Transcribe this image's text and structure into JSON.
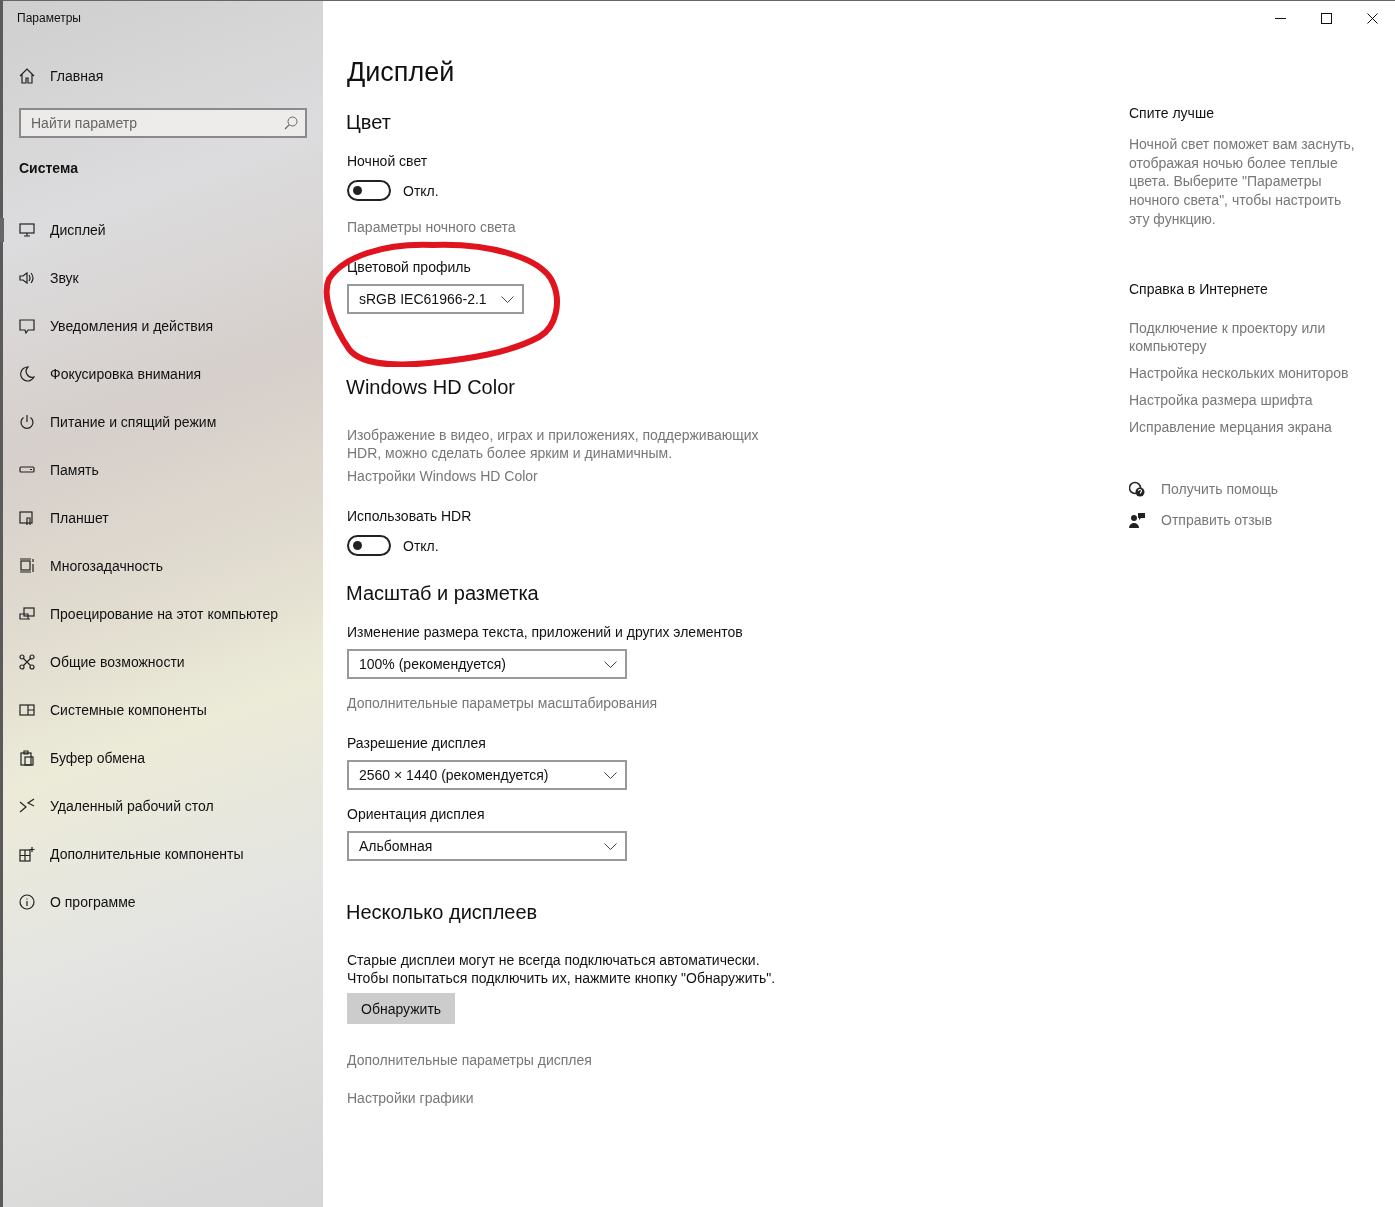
{
  "window": {
    "title": "Параметры",
    "controls": [
      {
        "kind": "minimize"
      },
      {
        "kind": "maximize"
      },
      {
        "kind": "close"
      }
    ]
  },
  "sidebar": {
    "home": {
      "label": "Главная"
    },
    "search": {
      "placeholder": "Найти параметр"
    },
    "section": "Система",
    "items": [
      {
        "label": "Дисплей",
        "selected": true
      },
      {
        "label": "Звук",
        "selected": false
      },
      {
        "label": "Уведомления и действия",
        "selected": false
      },
      {
        "label": "Фокусировка внимания",
        "selected": false
      },
      {
        "label": "Питание и спящий режим",
        "selected": false
      },
      {
        "label": "Память",
        "selected": false
      },
      {
        "label": "Планшет",
        "selected": false
      },
      {
        "label": "Многозадачность",
        "selected": false
      },
      {
        "label": "Проецирование на этот компьютер",
        "selected": false
      },
      {
        "label": "Общие возможности",
        "selected": false
      },
      {
        "label": "Системные компоненты",
        "selected": false
      },
      {
        "label": "Буфер обмена",
        "selected": false
      },
      {
        "label": "Удаленный рабочий стол",
        "selected": false
      },
      {
        "label": "Дополнительные компоненты",
        "selected": false
      },
      {
        "label": "О программе",
        "selected": false
      }
    ]
  },
  "page": {
    "title": "Дисплей",
    "sections": [
      {
        "heading": "Цвет",
        "items": [
          {
            "kind": "label",
            "text": "Ночной свет"
          },
          {
            "kind": "toggle",
            "on": false,
            "state": "Откл."
          },
          {
            "kind": "link",
            "text": "Параметры ночного света"
          },
          {
            "kind": "label",
            "text": "Цветовой профиль"
          },
          {
            "kind": "dropdown",
            "value": "sRGB IEC61966-2.1"
          }
        ]
      },
      {
        "heading": "Windows HD Color",
        "items": [
          {
            "kind": "note",
            "text": "Изображение в видео, играх и приложениях, поддерживающих HDR, можно сделать более ярким и динамичным."
          },
          {
            "kind": "link",
            "text": "Настройки Windows HD Color"
          },
          {
            "kind": "label",
            "text": "Использовать HDR"
          },
          {
            "kind": "toggle",
            "on": false,
            "state": "Откл."
          }
        ]
      },
      {
        "heading": "Масштаб и разметка",
        "items": [
          {
            "kind": "label",
            "text": "Изменение размера текста, приложений и других элементов"
          },
          {
            "kind": "dropdown",
            "value": "100% (рекомендуется)"
          },
          {
            "kind": "link",
            "text": "Дополнительные параметры масштабирования"
          },
          {
            "kind": "label",
            "text": "Разрешение дисплея"
          },
          {
            "kind": "dropdown",
            "value": "2560 × 1440 (рекомендуется)"
          },
          {
            "kind": "label",
            "text": "Ориентация дисплея"
          },
          {
            "kind": "dropdown",
            "value": "Альбомная"
          }
        ]
      },
      {
        "heading": "Несколько дисплеев",
        "items": [
          {
            "kind": "text",
            "text": "Старые дисплеи могут не всегда подключаться автоматически. Чтобы попытаться подключить их, нажмите кнопку \"Обнаружить\"."
          },
          {
            "kind": "button",
            "text": "Обнаружить"
          },
          {
            "kind": "link",
            "text": "Дополнительные параметры дисплея"
          },
          {
            "kind": "link",
            "text": "Настройки графики"
          }
        ]
      }
    ]
  },
  "annotation": {
    "kind": "ellipse"
  },
  "aside": {
    "sleep": {
      "heading": "Спите лучше",
      "text": "Ночной свет поможет вам заснуть, отображая ночью более теплые цвета. Выберите \"Параметры ночного света\", чтобы настроить эту функцию."
    },
    "help": {
      "heading": "Справка в Интернете",
      "links": [
        "Подключение к проектору или компьютеру",
        "Настройка нескольких мониторов",
        "Настройка размера шрифта",
        "Исправление мерцания экрана"
      ]
    },
    "actions": [
      {
        "label": "Получить помощь"
      },
      {
        "label": "Отправить отзыв"
      }
    ]
  }
}
